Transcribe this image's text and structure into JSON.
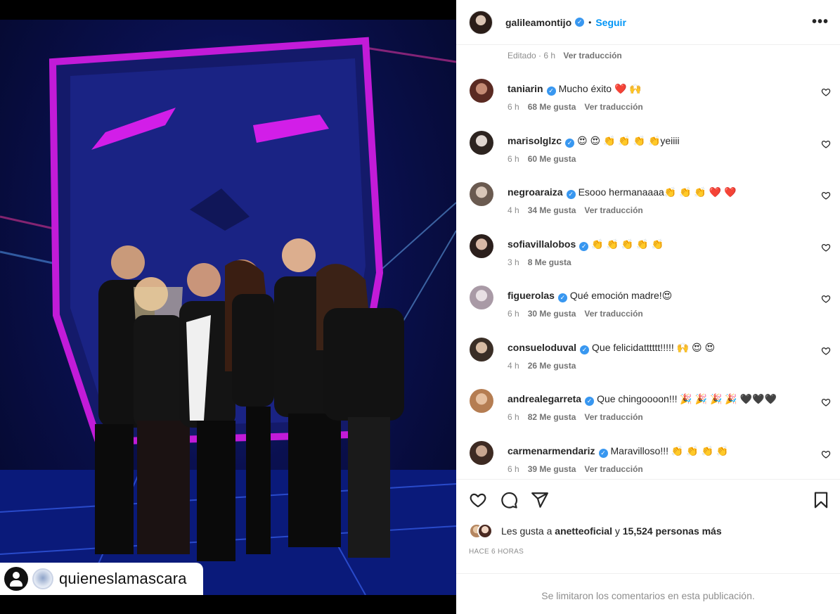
{
  "post": {
    "username": "galileamontijo",
    "follow_label": "Seguir",
    "separator": "•",
    "more_label": "•••",
    "edited_label": "Editado · 6 h",
    "see_translation": "Ver traducción",
    "repost_handle": "quieneslamascara"
  },
  "comments": [
    {
      "user": "taniarin",
      "text": "Mucho éxito ❤️ 🙌",
      "time": "6 h",
      "likes": "68 Me gusta",
      "translate": "Ver traducción"
    },
    {
      "user": "marisolglzc",
      "text": "😍 😍 👏 👏 👏 👏yeiiii",
      "time": "6 h",
      "likes": "60 Me gusta",
      "translate": ""
    },
    {
      "user": "negroaraiza",
      "text": "Esooo hermanaaaa👏 👏 👏 ❤️ ❤️",
      "time": "4 h",
      "likes": "34 Me gusta",
      "translate": "Ver traducción"
    },
    {
      "user": "sofiavillalobos",
      "text": "👏 👏 👏 👏 👏",
      "time": "3 h",
      "likes": "8 Me gusta",
      "translate": ""
    },
    {
      "user": "figuerolas",
      "text": "Qué emoción madre!😍",
      "time": "6 h",
      "likes": "30 Me gusta",
      "translate": "Ver traducción"
    },
    {
      "user": "consueloduval",
      "text": "Que felicidatttttt!!!!! 🙌 😍 😍",
      "time": "4 h",
      "likes": "26 Me gusta",
      "translate": ""
    },
    {
      "user": "andrealegarreta",
      "text": "Que chingoooon!!! 🎉 🎉 🎉 🎉 🖤🖤🖤",
      "time": "6 h",
      "likes": "82 Me gusta",
      "translate": "Ver traducción"
    },
    {
      "user": "carmenarmendariz",
      "text": "Maravilloso!!! 👏 👏 👏 👏",
      "time": "6 h",
      "likes": "39 Me gusta",
      "translate": "Ver traducción"
    }
  ],
  "likes_bar": {
    "prefix": "Les gusta a",
    "first_user": "anetteoficial",
    "conjunction": "y",
    "others": "15,524 personas más"
  },
  "timestamp": "HACE 6 HORAS",
  "comments_limited": "Se limitaron los comentarios en esta publicación.",
  "colors": {
    "accent": "#0095f6",
    "verified": "#3897f0",
    "muted": "#8e8e8e"
  }
}
